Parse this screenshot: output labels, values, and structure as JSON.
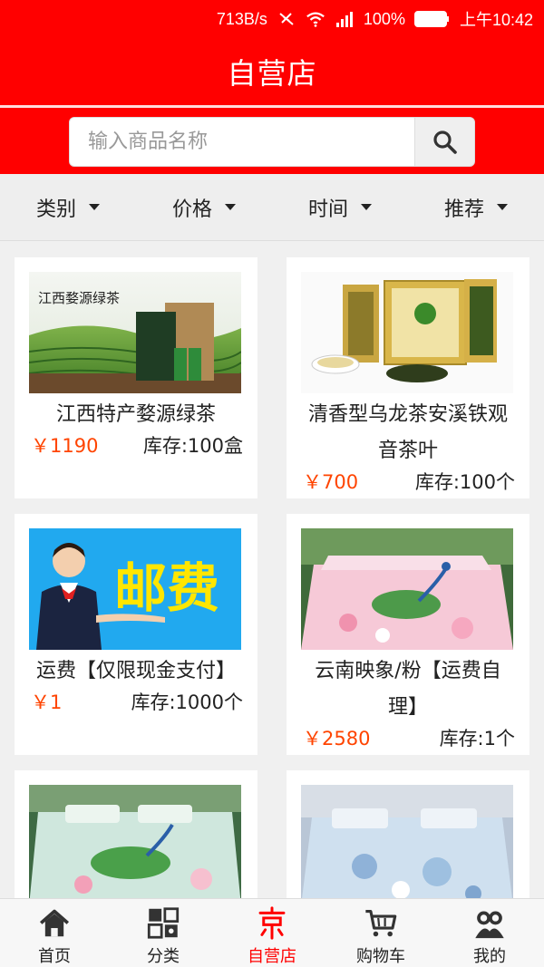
{
  "status": {
    "speed": "713B/s",
    "battery": "100%",
    "time": "上午10:42"
  },
  "header": {
    "title": "自营店"
  },
  "search": {
    "placeholder": "输入商品名称",
    "value": ""
  },
  "filters": [
    {
      "label": "类别"
    },
    {
      "label": "价格"
    },
    {
      "label": "时间"
    },
    {
      "label": "推荐"
    }
  ],
  "products": [
    {
      "name": "江西特产婺源绿茶",
      "price": "￥1190",
      "stock": "库存:100盒",
      "image": "tea-green-box"
    },
    {
      "name": "清香型乌龙茶安溪铁观音茶叶",
      "name_line1": "清香型乌龙茶安溪铁观",
      "name_line2": "音茶叶",
      "price": "￥700",
      "stock": "库存:100个",
      "image": "oolong-tin"
    },
    {
      "name": "运费【仅限现金支付】",
      "price": "￥1",
      "stock": "库存:1000个",
      "image": "postage-banner",
      "banner_text": "邮费"
    },
    {
      "name": "云南映象/粉【运费自理】",
      "name_line1": "云南映象/粉【运费自",
      "name_line2": "理】",
      "price": "￥2580",
      "stock": "库存:1个",
      "image": "peacock-bedding-pink"
    },
    {
      "name": "",
      "price": "",
      "stock": "",
      "image": "peacock-bedding-green"
    },
    {
      "name": "",
      "price": "",
      "stock": "",
      "image": "floral-bedding-blue"
    }
  ],
  "nav": [
    {
      "label": "首页",
      "icon": "home-icon"
    },
    {
      "label": "分类",
      "icon": "category-icon"
    },
    {
      "label": "自营店",
      "icon": "jd-store-icon",
      "active": true
    },
    {
      "label": "购物车",
      "icon": "cart-icon"
    },
    {
      "label": "我的",
      "icon": "profile-icon"
    }
  ],
  "colors": {
    "brand_red": "#ff0000",
    "price_orange": "#ff4400"
  }
}
